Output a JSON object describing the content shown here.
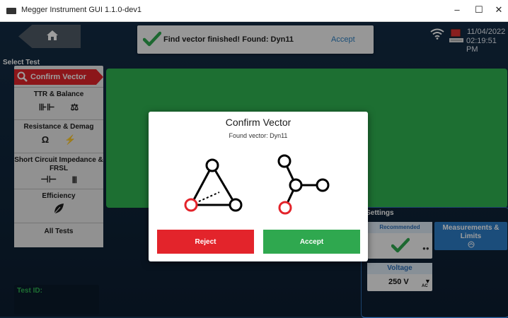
{
  "window": {
    "title": "Megger Instrument GUI 1.1.0-dev1",
    "controls": {
      "minimize": "–",
      "maximize": "☐",
      "close": "✕"
    }
  },
  "header": {
    "notification": {
      "message": "Find vector finished! Found: Dyn11",
      "action": "Accept"
    },
    "date": "11/04/2022",
    "time": "02:19:51 PM"
  },
  "sidebar": {
    "label": "Select Test",
    "items": [
      {
        "label": "Confirm Vector",
        "active": true
      },
      {
        "label": "TTR & Balance",
        "icons": [
          "⊪⊩",
          "⚖"
        ]
      },
      {
        "label": "Resistance & Demag",
        "icons": [
          "Ω",
          "⚡"
        ]
      },
      {
        "label": "Short Circuit Impedance & FRSL",
        "icons": [
          "⊣⊢",
          "𝍫"
        ]
      },
      {
        "label": "Efficiency",
        "icons": [
          "leaf-icon"
        ]
      },
      {
        "label": "All Tests"
      }
    ]
  },
  "test_id": {
    "label": "Test ID:"
  },
  "test_settings": {
    "header": "t Settings",
    "recommended": "Recommended",
    "measurements": "Measurements & Limits",
    "voltage": {
      "label": "Voltage",
      "value": "250 V",
      "unit": "AC"
    }
  },
  "dialog": {
    "title": "Confirm Vector",
    "subtitle": "Found vector: Dyn11",
    "reject_label": "Reject",
    "accept_label": "Accept"
  },
  "colors": {
    "accent_red": "#e3242b",
    "accent_green": "#2fb352",
    "accent_blue": "#2d7cc7"
  }
}
